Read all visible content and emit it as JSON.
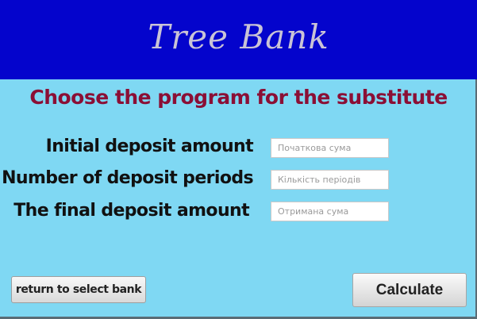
{
  "header": {
    "title": "Tree Bank",
    "background": "#0404cc",
    "title_color": "#c9c3d6"
  },
  "subtitle": "Choose the program for the substitute",
  "form": {
    "rows": [
      {
        "label": "Initial deposit amount",
        "placeholder": "Початкова сума",
        "value": ""
      },
      {
        "label": "Number of deposit periods",
        "placeholder": "Кількість періодів",
        "value": ""
      },
      {
        "label": "The final deposit amount",
        "placeholder": "Отримана сума",
        "value": ""
      }
    ]
  },
  "buttons": {
    "return_label": "return to select bank",
    "calculate_label": "Calculate"
  },
  "colors": {
    "background": "#7fd8f3",
    "subtitle": "#8b0f35"
  }
}
